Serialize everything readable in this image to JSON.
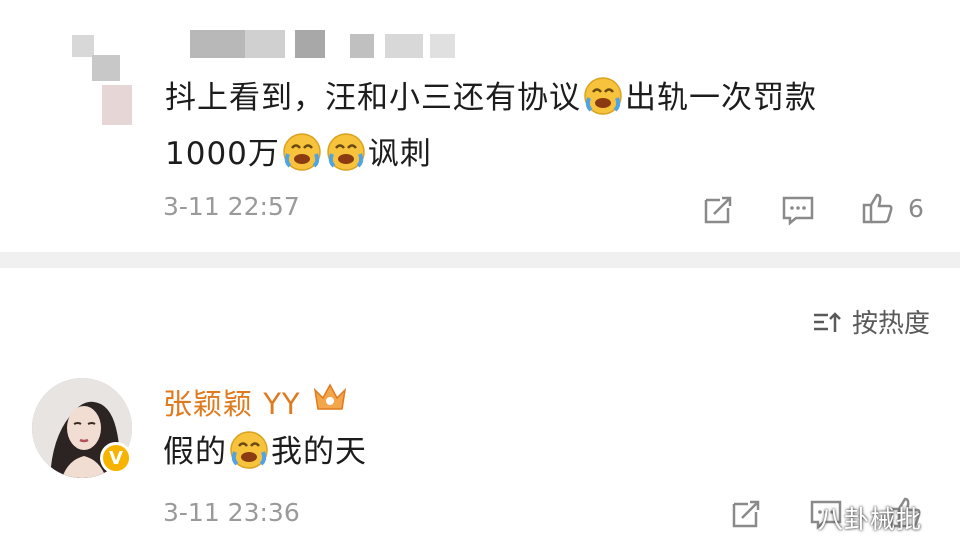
{
  "comment1": {
    "text_line1_a": "抖上看到，汪和小三还有协议",
    "text_line1_b": "出轨一次罚款",
    "text_line2_a": "1000万",
    "text_line2_b": "讽刺",
    "time": "3-11 22:57",
    "like_count": "6",
    "emoji": "laugh-cry-icon"
  },
  "sort": {
    "label": "按热度"
  },
  "comment2": {
    "user_name": "张颖颖 YY",
    "text_a": "假的",
    "text_b": "我的天",
    "time": "3-11 23:36",
    "verified_badge": "V"
  },
  "watermark": {
    "text": "八卦械批"
  },
  "colors": {
    "username": "#e07a1f",
    "meta": "#9a9a9a",
    "badge": "#f6b400",
    "emoji": "#f7c33c"
  }
}
